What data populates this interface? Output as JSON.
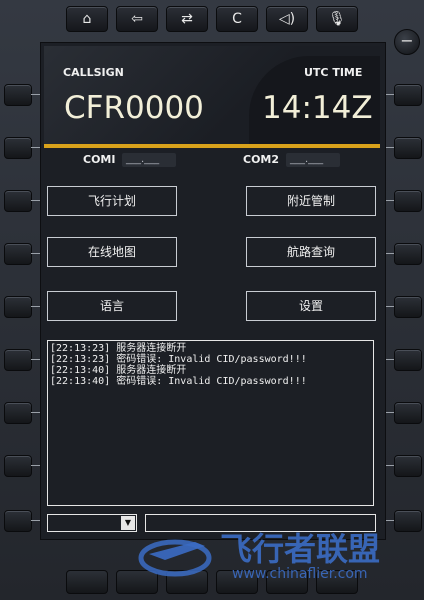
{
  "toolbar": {
    "buttons": [
      {
        "name": "home-icon",
        "glyph": "⌂"
      },
      {
        "name": "back-icon",
        "glyph": "⇦"
      },
      {
        "name": "swap-icon",
        "glyph": "⇄"
      },
      {
        "name": "clear-label",
        "glyph": "C"
      },
      {
        "name": "speaker-icon",
        "glyph": "🔈"
      },
      {
        "name": "microphone-icon",
        "glyph": "🎙"
      }
    ]
  },
  "header": {
    "callsign_label": "CALLSIGN",
    "callsign_value": "CFR0000",
    "utc_label": "UTC TIME",
    "utc_value": "14:14Z"
  },
  "com": {
    "com1_label": "COMI",
    "com1_value": "___.___",
    "com2_label": "COM2",
    "com2_value": "___.___"
  },
  "menu": {
    "flight_plan": "飞行计划",
    "nearby_atc": "附近管制",
    "online_map": "在线地图",
    "route_query": "航路查询",
    "language": "语言",
    "settings": "设置"
  },
  "log": {
    "lines": [
      "[22:13:23] 服务器连接断开",
      "[22:13:23] 密码错误: Invalid CID/password!!!",
      "[22:13:40] 服务器连接断开",
      "[22:13:40] 密码错误: Invalid CID/password!!!"
    ]
  },
  "watermark": {
    "text": "飞行者联盟",
    "url": "www.chinaflier.com"
  },
  "colors": {
    "accent": "#d9a21b",
    "watermark": "#3b6cc4"
  }
}
